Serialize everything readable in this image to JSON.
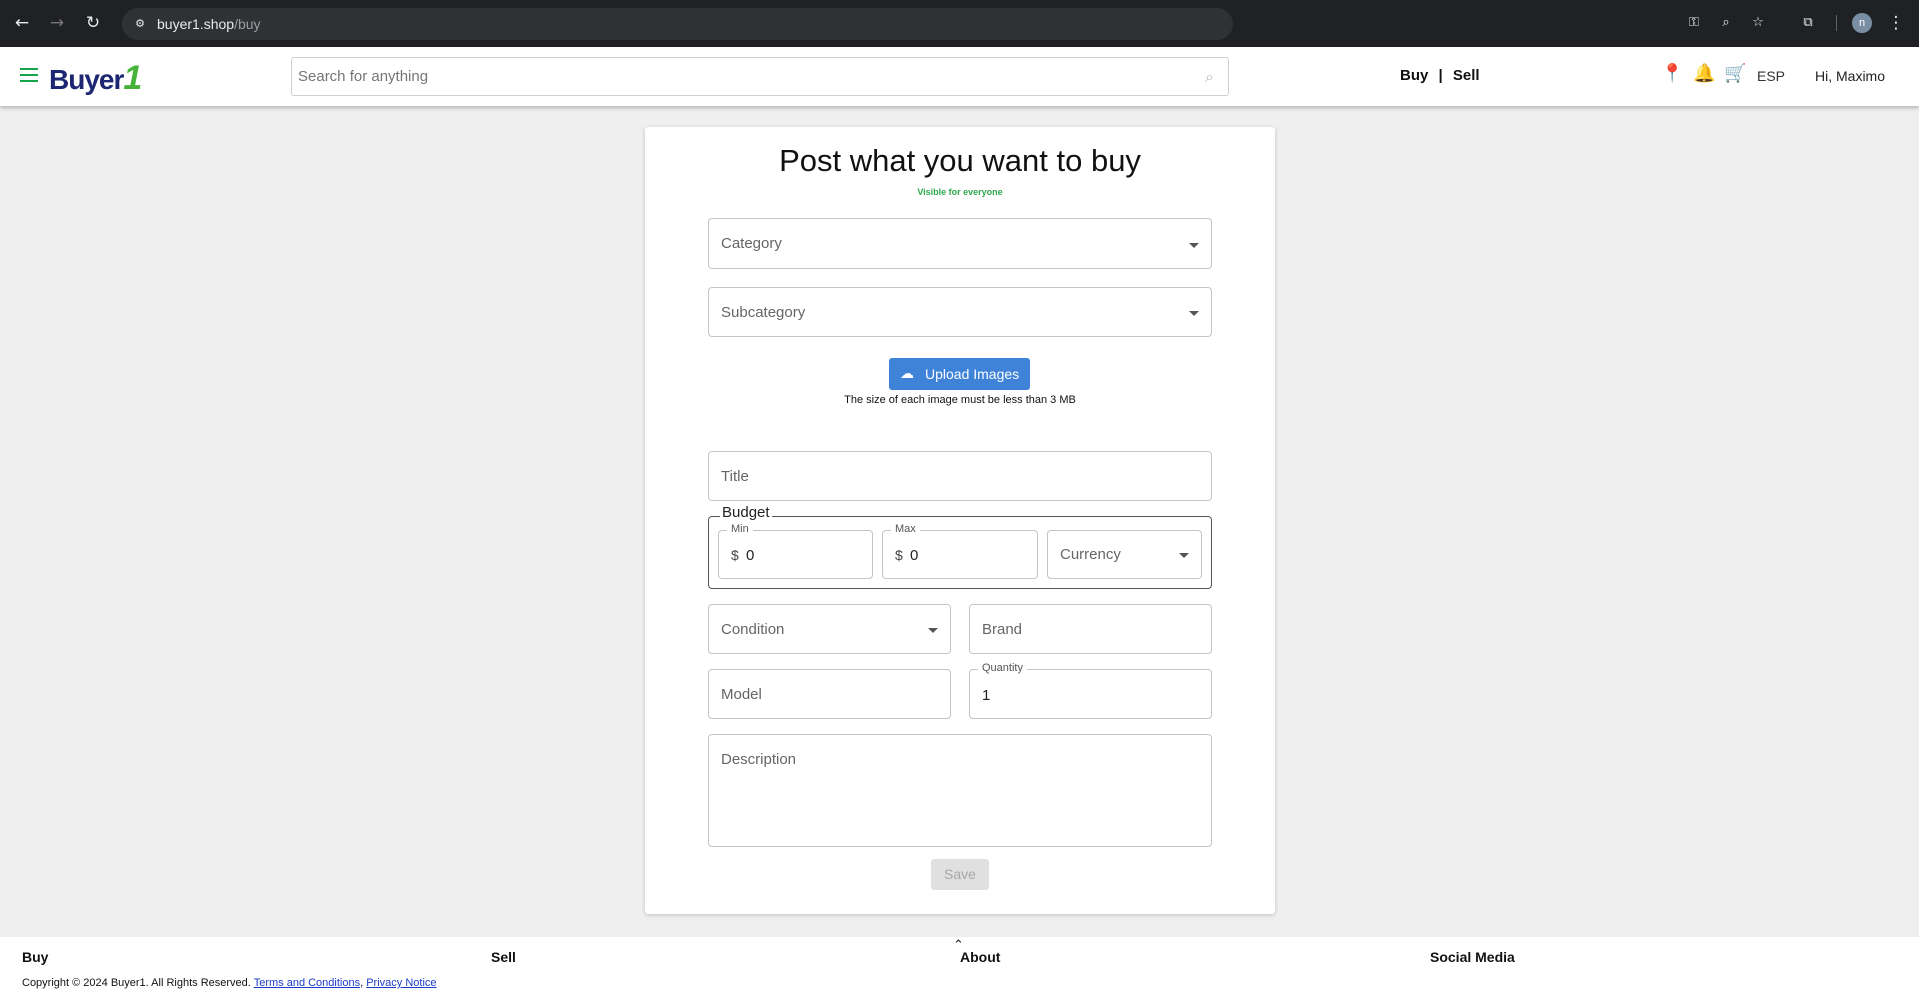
{
  "browser": {
    "url_host": "buyer1.shop",
    "url_path": "/buy",
    "profile_initial": "n"
  },
  "header": {
    "logo_text": "Buyer",
    "logo_mark": "1",
    "search_placeholder": "Search for anything",
    "buy_label": "Buy",
    "separator": "|",
    "sell_label": "Sell",
    "language": "ESP",
    "greeting": "Hi, Maximo"
  },
  "form": {
    "title": "Post what you want to buy",
    "visibility": "Visible for everyone",
    "category_placeholder": "Category",
    "subcategory_placeholder": "Subcategory",
    "upload_label": "Upload Images",
    "upload_note": "The size of each image must be less than 3 MB",
    "title_placeholder": "Title",
    "budget_legend": "Budget",
    "min_label": "Min",
    "max_label": "Max",
    "currency_symbol": "$",
    "min_value": "0",
    "max_value": "0",
    "currency_placeholder": "Currency",
    "condition_placeholder": "Condition",
    "brand_placeholder": "Brand",
    "model_placeholder": "Model",
    "quantity_label": "Quantity",
    "quantity_value": "1",
    "description_placeholder": "Description",
    "save_label": "Save"
  },
  "footer": {
    "col_buy": "Buy",
    "col_sell": "Sell",
    "col_about": "About",
    "col_social": "Social Media",
    "copyright": "Copyright © 2024 Buyer1. All Rights Reserved.",
    "terms_link": "Terms and Conditions",
    "comma": ",",
    "privacy_link": "Privacy Notice"
  },
  "colors": {
    "accent_blue": "#3f83d8",
    "logo_navy": "#1d2672",
    "logo_green": "#45b33a",
    "visibility_green": "#2fa84f"
  }
}
